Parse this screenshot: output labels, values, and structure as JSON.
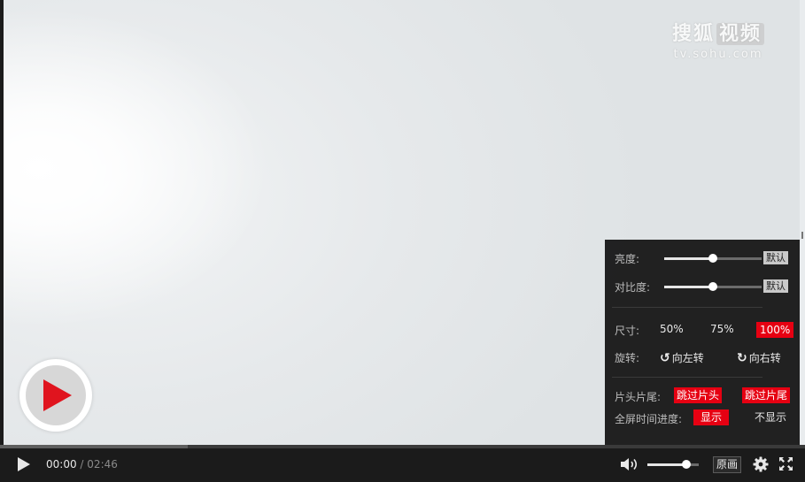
{
  "watermark": {
    "name_a": "搜狐",
    "name_b": "视频",
    "url": "tv.sohu.com"
  },
  "big_play": {
    "icon": "play-icon",
    "color": "#e0141e"
  },
  "settings": {
    "brightness": {
      "label": "亮度:",
      "level": 0.5,
      "reset_label": "默认"
    },
    "contrast": {
      "label": "对比度:",
      "level": 0.5,
      "reset_label": "默认"
    },
    "size": {
      "label": "尺寸:",
      "options": [
        "50%",
        "75%",
        "100%"
      ],
      "selected": "100%"
    },
    "rotate": {
      "label": "旋转:",
      "left_label": "向左转",
      "right_label": "向右转",
      "left_icon": "rotate-left-icon",
      "right_icon": "rotate-right-icon"
    },
    "skip": {
      "label": "片头片尾:",
      "skip_intro_label": "跳过片头",
      "skip_outro_label": "跳过片尾"
    },
    "fullscreen_progress": {
      "label": "全屏时间进度:",
      "show_label": "显示",
      "hide_label": "不显示",
      "selected": "显示"
    },
    "accent_color": "#e60012"
  },
  "controls": {
    "current_time": "00:00",
    "separator": "/",
    "duration": "02:46",
    "buffered_fraction": 0.233,
    "volume_level": 0.75,
    "quality_label": "原画",
    "icons": [
      "play-icon",
      "volume-icon",
      "gear-icon",
      "fullscreen-icon"
    ]
  }
}
